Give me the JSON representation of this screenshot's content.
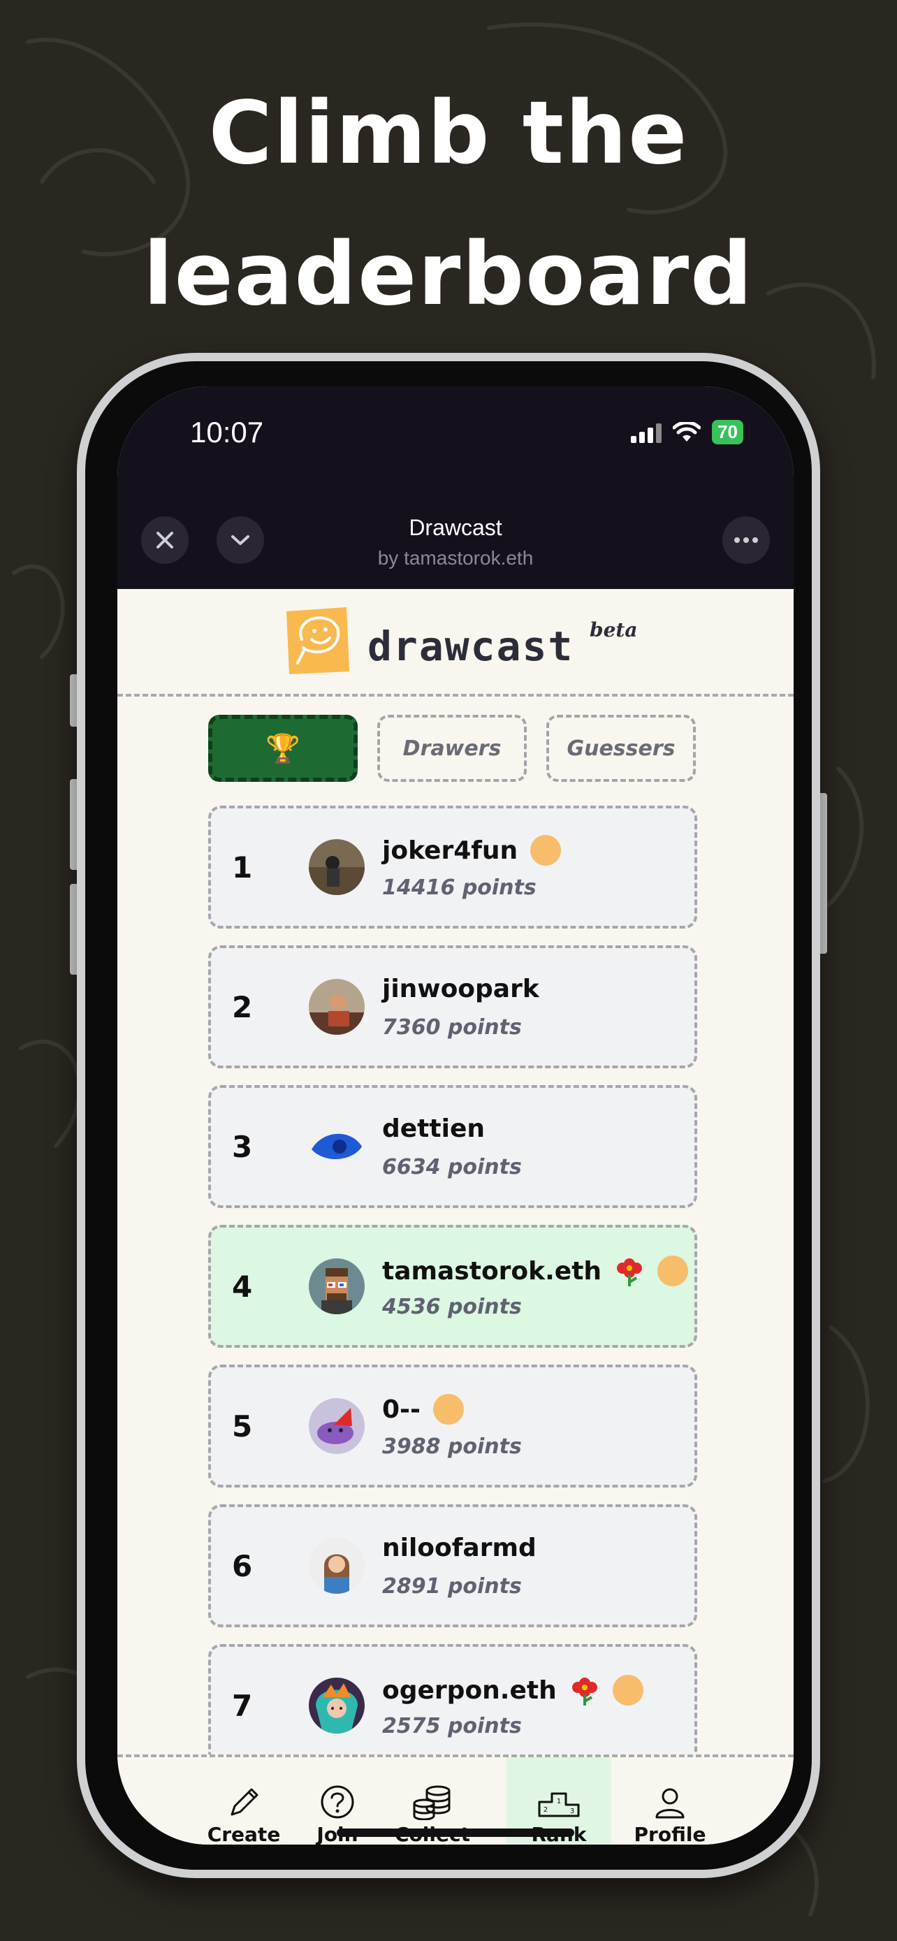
{
  "headline": {
    "line1": "Climb the",
    "line2": "leaderboard"
  },
  "status_bar": {
    "time": "10:07",
    "battery": "70"
  },
  "app_bar": {
    "title": "Drawcast",
    "subtitle": "by tamastorok.eth",
    "close_icon": "close-icon",
    "collapse_icon": "chevron-down-icon",
    "more_icon": "more-horizontal-icon"
  },
  "brand": {
    "name": "drawcast",
    "badge": "beta"
  },
  "tabs": [
    {
      "label": "🏆",
      "icon": "trophy-icon",
      "active": true
    },
    {
      "label": "Drawers",
      "active": false
    },
    {
      "label": "Guessers",
      "active": false
    }
  ],
  "leaderboard": [
    {
      "rank": "1",
      "name": "joker4fun",
      "points": "14416 points",
      "badges": [
        "coin"
      ]
    },
    {
      "rank": "2",
      "name": "jinwoopark",
      "points": "7360 points",
      "badges": []
    },
    {
      "rank": "3",
      "name": "dettien",
      "points": "6634 points",
      "badges": []
    },
    {
      "rank": "4",
      "name": "tamastorok.eth",
      "points": "4536 points",
      "badges": [
        "flower",
        "coin"
      ],
      "highlighted": true
    },
    {
      "rank": "5",
      "name": "0--",
      "points": "3988 points",
      "badges": [
        "coin"
      ]
    },
    {
      "rank": "6",
      "name": "niloofarmd",
      "points": "2891 points",
      "badges": []
    },
    {
      "rank": "7",
      "name": "ogerpon.eth",
      "points": "2575 points",
      "badges": [
        "flower",
        "coin"
      ]
    }
  ],
  "bottom_nav": [
    {
      "label": "Create",
      "icon": "pencil-icon",
      "active": false
    },
    {
      "label": "Join",
      "icon": "question-icon",
      "active": false
    },
    {
      "label": "Collect",
      "icon": "coins-stack-icon",
      "active": false
    },
    {
      "label": "Rank",
      "icon": "podium-icon",
      "active": true
    },
    {
      "label": "Profile",
      "icon": "user-icon",
      "active": false
    }
  ],
  "colors": {
    "background": "#2a2620",
    "active_tab": "#1e6a33",
    "highlight_row": "#dcf7e2",
    "coin": "#f7bd6a",
    "logo": "#f9b94f"
  }
}
